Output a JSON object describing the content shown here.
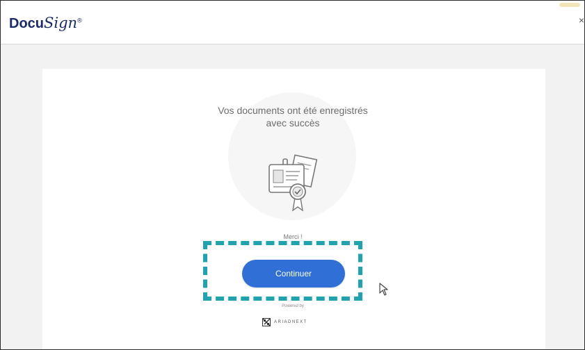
{
  "app": {
    "logo_part1": "Docu",
    "logo_part2": "Sign",
    "logo_tm": "®",
    "close_glyph": "×"
  },
  "success": {
    "message": "Vos documents ont été enregistrés avec succès",
    "thanks": "Merci !",
    "button_label": "Continuer"
  },
  "footer": {
    "powered_by": "Powered by",
    "brand": "ARIADNEXT"
  },
  "icons": {
    "illustration": "documents-certificate-icon",
    "cursor": "mouse-pointer-icon",
    "brand": "ariadnext-logo-icon"
  },
  "colors": {
    "button": "#2f6fd6",
    "highlight": "#1fa3b0",
    "logo": "#1a2b6d"
  }
}
